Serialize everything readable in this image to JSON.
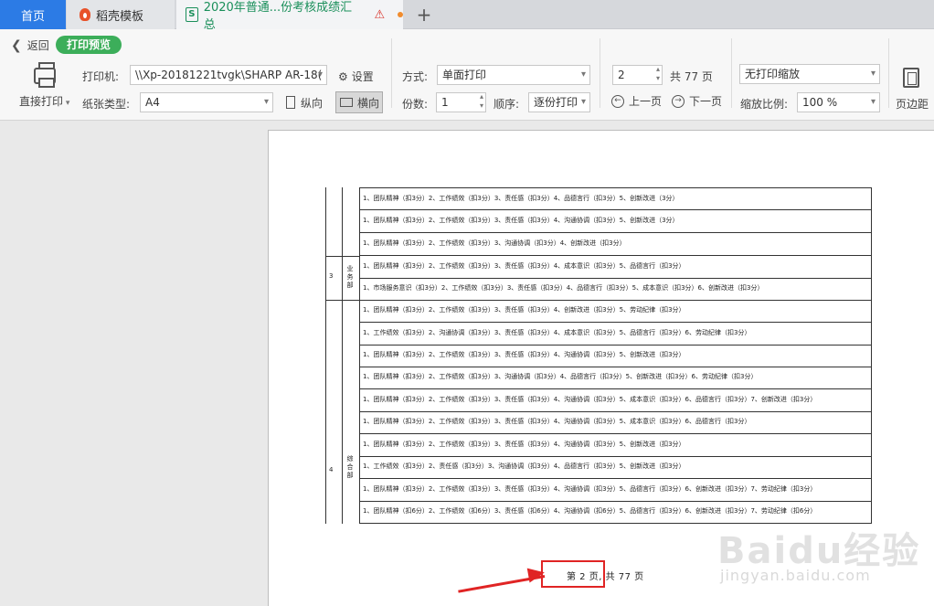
{
  "tabs": [
    {
      "label": "首页"
    },
    {
      "label": "稻壳模板"
    },
    {
      "label": "2020年普通...份考核成绩汇总"
    }
  ],
  "toolbar": {
    "back_label": "返回",
    "mode_label": "打印预览",
    "direct_print_label": "直接打印",
    "printer_label": "打印机:",
    "printer_value": "\\\\Xp-20181221tvgk\\SHARP AR-18(",
    "settings_label": "设置",
    "paper_label": "纸张类型:",
    "paper_value": "A4",
    "portrait_label": "纵向",
    "landscape_label": "横向",
    "method_label": "方式:",
    "method_value": "单面打印",
    "copies_label": "份数:",
    "copies_value": "1",
    "order_label": "顺序:",
    "order_value": "逐份打印",
    "page_value": "2",
    "total_pages_label": "共 77 页",
    "prev_label": "上一页",
    "next_label": "下一页",
    "scaling_value": "无打印缩放",
    "zoom_label": "缩放比例:",
    "zoom_value": "100 %",
    "margins_label": "页边距"
  },
  "sheet": {
    "rows": [
      "1、团队精神（扣3分）2、工作绩效（扣3分）3、责任感（扣3分）4、品德言行（扣3分）5、创新改进（3分）",
      "1、团队精神（扣3分）2、工作绩效（扣3分）3、责任感（扣3分）4、沟通协调（扣3分）5、创新改进（3分）",
      "1、团队精神（扣3分）2、工作绩效（扣3分）3、沟通协调（扣3分）4、创新改进（扣3分）",
      "1、团队精神（扣3分）2、工作绩效（扣3分）3、责任感（扣3分）4、成本意识（扣3分）5、品德言行（扣3分）",
      "1、市场服务意识（扣3分）2、工作绩效（扣3分）3、责任感（扣3分）4、品德言行（扣3分）5、成本意识（扣3分）6、创新改进（扣3分）",
      "1、团队精神（扣3分）2、工作绩效（扣3分）3、责任感（扣3分）4、创新改进（扣3分）5、劳动纪律（扣3分）",
      "1、工作绩效（扣3分）2、沟通协调（扣3分）3、责任感（扣3分）4、成本意识（扣3分）5、品德言行（扣3分）6、劳动纪律（扣3分）",
      "1、团队精神（扣3分）2、工作绩效（扣3分）3、责任感（扣3分）4、沟通协调（扣3分）5、创新改进（扣3分）",
      "1、团队精神（扣3分）2、工作绩效（扣3分）3、沟通协调（扣3分）4、品德言行（扣3分）5、创新改进（扣3分）6、劳动纪律（扣3分）",
      "1、团队精神（扣3分）2、工作绩效（扣3分）3、责任感（扣3分）4、沟通协调（扣3分）5、成本意识（扣3分）6、品德言行（扣3分）7、创新改进（扣3分）",
      "1、团队精神（扣3分）2、工作绩效（扣3分）3、责任感（扣3分）4、沟通协调（扣3分）5、成本意识（扣3分）6、品德言行（扣3分）",
      "1、团队精神（扣3分）2、工作绩效（扣3分）3、责任感（扣3分）4、沟通协调（扣3分）5、创新改进（扣3分）",
      "1、工作绩效（扣3分）2、责任感（扣3分）3、沟通协调（扣3分）4、品德言行（扣3分）5、创新改进（扣3分）",
      "1、团队精神（扣3分）2、工作绩效（扣3分）3、责任感（扣3分）4、沟通协调（扣3分）5、品德言行（扣3分）6、创新改进（扣3分）7、劳动纪律（扣3分）",
      "1、团队精神（扣6分）2、工作绩效（扣6分）3、责任感（扣6分）4、沟通协调（扣6分）5、品德言行（扣3分）6、创新改进（扣3分）7、劳动纪律（扣6分）"
    ],
    "dept3_num": "3",
    "dept3_name": "业务部",
    "dept4_num": "4",
    "dept4_name": "综合部",
    "footer": "第 2 页, 共 77 页"
  },
  "watermark": {
    "brand": "Baidu经验",
    "url": "jingyan.baidu.com"
  },
  "colors": {
    "accent": "#2c7be5",
    "success": "#3cae5a",
    "annotation": "#e02424"
  }
}
